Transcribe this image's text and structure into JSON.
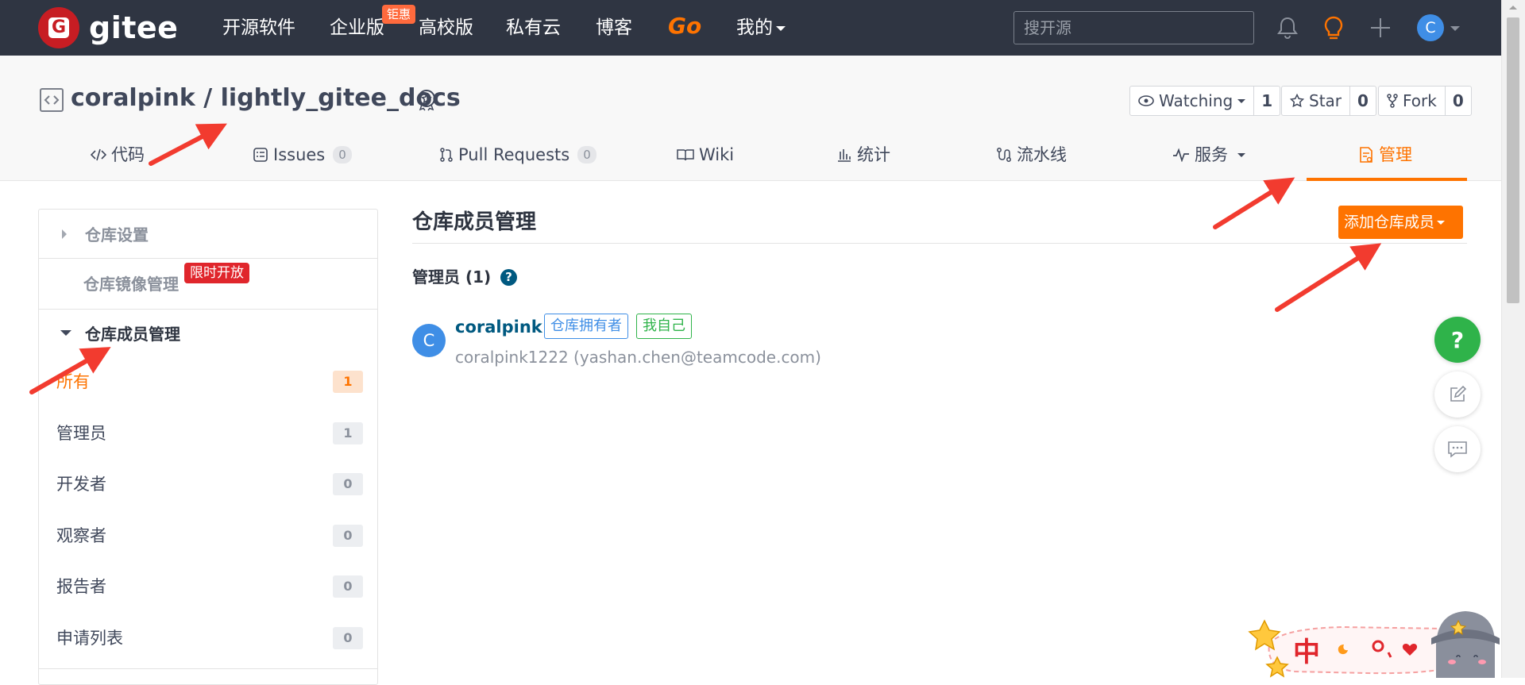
{
  "topbar": {
    "logo_text": "gitee",
    "nav": [
      "开源软件",
      "企业版",
      "高校版",
      "私有云",
      "博客",
      "Go",
      "我的"
    ],
    "hot_tag": "钜惠",
    "search_placeholder": "搜开源",
    "avatar_initial": "C"
  },
  "repo": {
    "title": "coralpink / lightly_gitee_docs",
    "watch_label": "Watching",
    "watch_count": "1",
    "star_label": "Star",
    "star_count": "0",
    "fork_label": "Fork",
    "fork_count": "0"
  },
  "tabs": [
    {
      "label": "代码",
      "icon": "code-icon"
    },
    {
      "label": "Issues",
      "count": "0",
      "icon": "issues-icon"
    },
    {
      "label": "Pull Requests",
      "count": "0",
      "icon": "pull-request-icon"
    },
    {
      "label": "Wiki",
      "icon": "book-icon"
    },
    {
      "label": "统计",
      "icon": "bar-chart-icon"
    },
    {
      "label": "流水线",
      "icon": "pipeline-icon"
    },
    {
      "label": "服务",
      "icon": "pulse-icon"
    },
    {
      "label": "管理",
      "icon": "settings-doc-icon",
      "active": true
    }
  ],
  "sidebar": {
    "repo_settings": "仓库设置",
    "mirror_management": "仓库镜像管理",
    "limited_tag": "限时开放",
    "member_management": "仓库成员管理",
    "items": [
      {
        "label": "所有",
        "count": "1",
        "active": true
      },
      {
        "label": "管理员",
        "count": "1"
      },
      {
        "label": "开发者",
        "count": "0"
      },
      {
        "label": "观察者",
        "count": "0"
      },
      {
        "label": "报告者",
        "count": "0"
      },
      {
        "label": "申请列表",
        "count": "0"
      }
    ]
  },
  "main": {
    "title": "仓库成员管理",
    "add_button": "添加仓库成员",
    "admin_section": "管理员 (1)",
    "member": {
      "initial": "C",
      "name": "coralpink",
      "owner_tag": "仓库拥有者",
      "self_tag": "我自己",
      "detail": "coralpink1222 (yashan.chen@teamcode.com)"
    }
  },
  "floating": {
    "help": "?"
  },
  "sticker": {
    "text": "中"
  },
  "colors": {
    "topbar": "#2f3542",
    "accent": "#fe7300",
    "brand_red": "#c71d23",
    "link": "#005980",
    "annotation": "#f23b2f"
  }
}
